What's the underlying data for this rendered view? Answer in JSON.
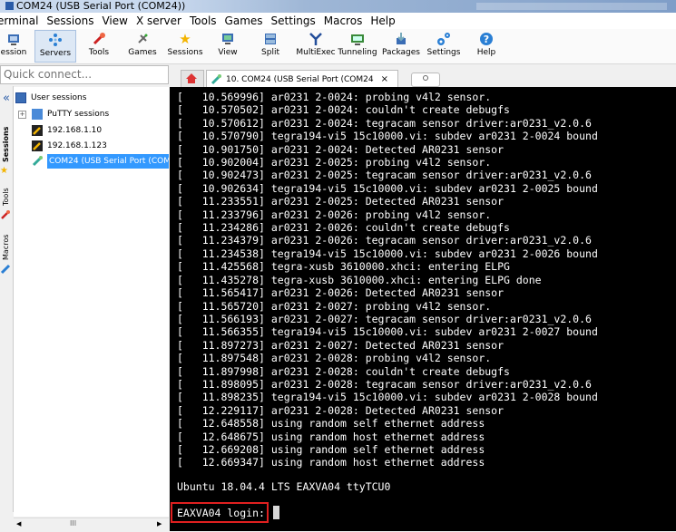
{
  "window": {
    "title": "COM24  (USB Serial Port (COM24))"
  },
  "menu": [
    "erminal",
    "Sessions",
    "View",
    "X server",
    "Tools",
    "Games",
    "Settings",
    "Macros",
    "Help"
  ],
  "toolbar": {
    "buttons": [
      {
        "label": "ession",
        "icon": "session-icon"
      },
      {
        "label": "Servers",
        "icon": "servers-icon",
        "active": true
      },
      {
        "label": "Tools",
        "icon": "tools-icon"
      },
      {
        "label": "Games",
        "icon": "games-icon"
      },
      {
        "label": "Sessions",
        "icon": "star-icon"
      },
      {
        "label": "View",
        "icon": "view-icon"
      },
      {
        "label": "Split",
        "icon": "split-icon"
      },
      {
        "label": "MultiExec",
        "icon": "multiexec-icon"
      },
      {
        "label": "Tunneling",
        "icon": "tunneling-icon"
      },
      {
        "label": "Packages",
        "icon": "packages-icon"
      },
      {
        "label": "Settings",
        "icon": "settings-icon"
      },
      {
        "label": "Help",
        "icon": "help-icon"
      }
    ]
  },
  "quick_connect": {
    "placeholder": "Quick connect..."
  },
  "side_tabs": [
    "Sessions",
    "Tools",
    "Macros"
  ],
  "tree": [
    {
      "label": "User sessions"
    },
    {
      "label": "PuTTY sessions",
      "expand": "+"
    },
    {
      "label": "192.168.1.10"
    },
    {
      "label": "192.168.1.123"
    },
    {
      "label": "COM24  (USB Serial Port (COM2",
      "selected": true
    }
  ],
  "tabs": {
    "active": "10. COM24  (USB Serial Port (COM24",
    "close": "×"
  },
  "terminal": {
    "log": [
      "[   10.569996] ar0231 2-0024: probing v4l2 sensor.",
      "[   10.570502] ar0231 2-0024: couldn't create debugfs",
      "[   10.570612] ar0231 2-0024: tegracam sensor driver:ar0231_v2.0.6",
      "[   10.570790] tegra194-vi5 15c10000.vi: subdev ar0231 2-0024 bound",
      "[   10.901750] ar0231 2-0024: Detected AR0231 sensor",
      "[   10.902004] ar0231 2-0025: probing v4l2 sensor.",
      "[   10.902473] ar0231 2-0025: tegracam sensor driver:ar0231_v2.0.6",
      "[   10.902634] tegra194-vi5 15c10000.vi: subdev ar0231 2-0025 bound",
      "[   11.233551] ar0231 2-0025: Detected AR0231 sensor",
      "[   11.233796] ar0231 2-0026: probing v4l2 sensor.",
      "[   11.234286] ar0231 2-0026: couldn't create debugfs",
      "[   11.234379] ar0231 2-0026: tegracam sensor driver:ar0231_v2.0.6",
      "[   11.234538] tegra194-vi5 15c10000.vi: subdev ar0231 2-0026 bound",
      "[   11.425568] tegra-xusb 3610000.xhci: entering ELPG",
      "[   11.435278] tegra-xusb 3610000.xhci: entering ELPG done",
      "[   11.565417] ar0231 2-0026: Detected AR0231 sensor",
      "[   11.565720] ar0231 2-0027: probing v4l2 sensor.",
      "[   11.566193] ar0231 2-0027: tegracam sensor driver:ar0231_v2.0.6",
      "[   11.566355] tegra194-vi5 15c10000.vi: subdev ar0231 2-0027 bound",
      "[   11.897273] ar0231 2-0027: Detected AR0231 sensor",
      "[   11.897548] ar0231 2-0028: probing v4l2 sensor.",
      "[   11.897998] ar0231 2-0028: couldn't create debugfs",
      "[   11.898095] ar0231 2-0028: tegracam sensor driver:ar0231_v2.0.6",
      "[   11.898235] tegra194-vi5 15c10000.vi: subdev ar0231 2-0028 bound",
      "[   12.229117] ar0231 2-0028: Detected AR0231 sensor",
      "[   12.648558] using random self ethernet address",
      "[   12.648675] using random host ethernet address",
      "[   12.669208] using random self ethernet address",
      "[   12.669347] using random host ethernet address"
    ],
    "banner": "Ubuntu 18.04.4 LTS EAXVA04 ttyTCU0",
    "prompt": "EAXVA04 login:",
    "highlight_color": "#e02020"
  },
  "scrollbar": {
    "left": "◀",
    "right": "▶",
    "grip": "III"
  }
}
